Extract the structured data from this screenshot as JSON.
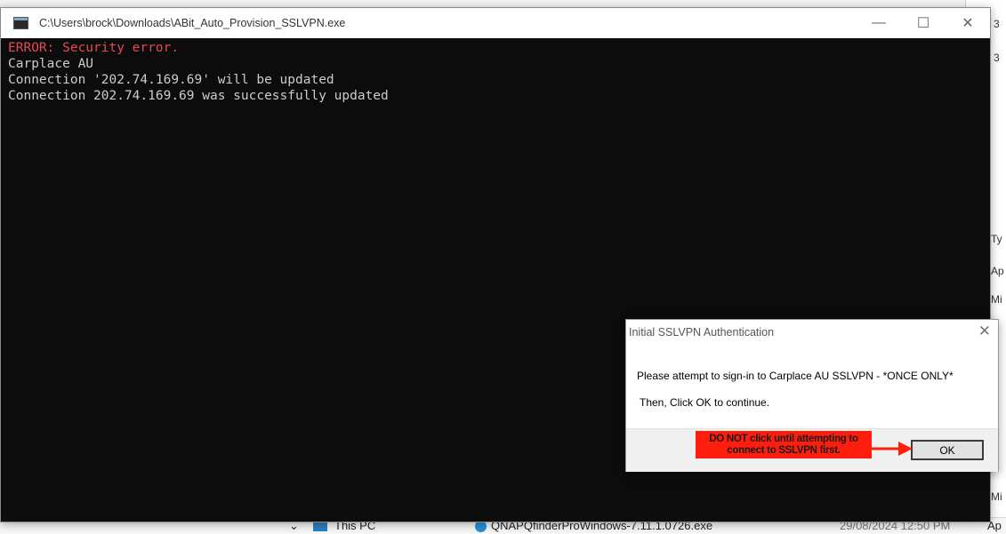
{
  "background": {
    "right_fragments": [
      "3",
      "3",
      "Ty",
      "Ap",
      "Mi",
      "Mi",
      "Ap"
    ],
    "bottom_strip": {
      "item1_label": "This PC",
      "item2_label": "QNAPQfinderProWindows-7.11.1.0726.exe",
      "date_text": "29/08/2024 12:50 PM",
      "right_text": "Ap"
    }
  },
  "console": {
    "title": "C:\\Users\\brock\\Downloads\\ABit_Auto_Provision_SSLVPN.exe",
    "controls": {
      "minimize": "—",
      "maximize": "☐",
      "close": "✕"
    },
    "lines": [
      "ERROR: Security error.",
      "Carplace AU",
      "Connection '202.74.169.69' will be updated",
      "Connection 202.74.169.69 was successfully updated"
    ],
    "colors": {
      "error": "#e74856",
      "text": "#cccccc",
      "background": "#0c0c0c"
    }
  },
  "dialog": {
    "title": "Initial SSLVPN Authentication",
    "close_glyph": "✕",
    "message": "Please attempt to sign-in to Carplace AU SSLVPN - *ONCE ONLY*",
    "message2": "Then, Click OK to continue.",
    "ok_label": "OK"
  },
  "annotation": {
    "line1": "DO NOT click until attempting to",
    "line2": "connect to SSLVPN first.",
    "color": "#ff1e0e"
  }
}
